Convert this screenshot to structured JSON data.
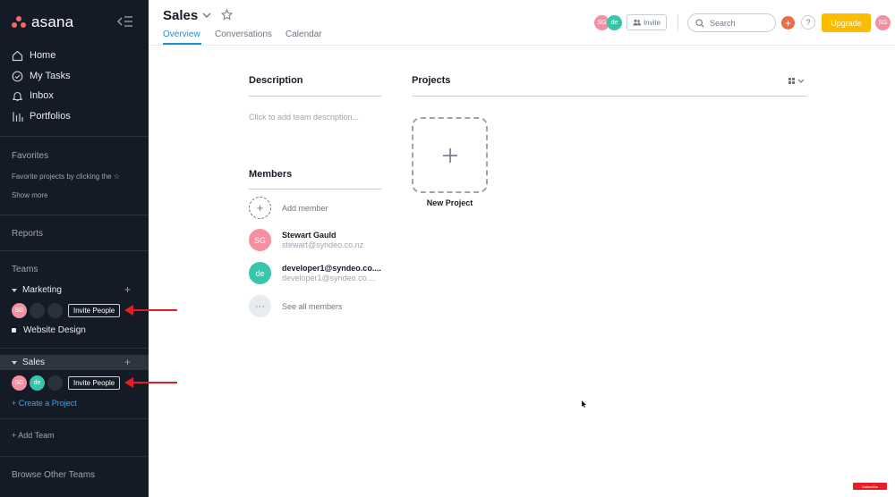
{
  "sidebar": {
    "logo_text": "asana",
    "nav": [
      {
        "label": "Home",
        "icon": "home-icon"
      },
      {
        "label": "My Tasks",
        "icon": "check-circle-icon"
      },
      {
        "label": "Inbox",
        "icon": "bell-icon"
      },
      {
        "label": "Portfolios",
        "icon": "bar-chart-icon"
      }
    ],
    "favorites_title": "Favorites",
    "favorites_hint": "Favorite projects by clicking the ☆",
    "show_more": "Show more",
    "reports_title": "Reports",
    "teams_title": "Teams",
    "teams": [
      {
        "name": "Marketing",
        "avatars": [
          "SG"
        ],
        "invite_label": "Invite People",
        "projects": [
          "Website Design"
        ]
      },
      {
        "name": "Sales",
        "avatars": [
          "SG",
          "de"
        ],
        "invite_label": "Invite People",
        "create_project": "+ Create a Project"
      }
    ],
    "add_team": "+ Add Team",
    "browse_teams": "Browse Other Teams"
  },
  "header": {
    "title": "Sales",
    "tabs": [
      "Overview",
      "Conversations",
      "Calendar"
    ],
    "active_tab": "Overview",
    "member_avatars": [
      "SG",
      "de"
    ],
    "invite_label": "Invite",
    "search_placeholder": "Search",
    "help_label": "?",
    "upgrade_label": "Upgrade",
    "user_avatar": "SG"
  },
  "description": {
    "title": "Description",
    "placeholder": "Click to add team description..."
  },
  "members": {
    "title": "Members",
    "add_label": "Add member",
    "list": [
      {
        "initials": "SG",
        "name": "Stewart Gauld",
        "email": "stewart@syndeo.co.nz"
      },
      {
        "initials": "de",
        "name": "developer1@syndeo.co....",
        "email": "developer1@syndeo.co...."
      }
    ],
    "see_all": "See all members"
  },
  "projects": {
    "title": "Projects",
    "new_project_label": "New Project"
  },
  "overlay": {
    "subscribe_badge": "Subscribe"
  },
  "colors": {
    "sidebar_bg": "#151b26",
    "accent_blue": "#1f8fd6",
    "upgrade_yellow": "#fcbd01",
    "avatar_pink": "#f58fa1",
    "avatar_teal": "#37c5ab",
    "annotation_red": "#e31e24"
  }
}
